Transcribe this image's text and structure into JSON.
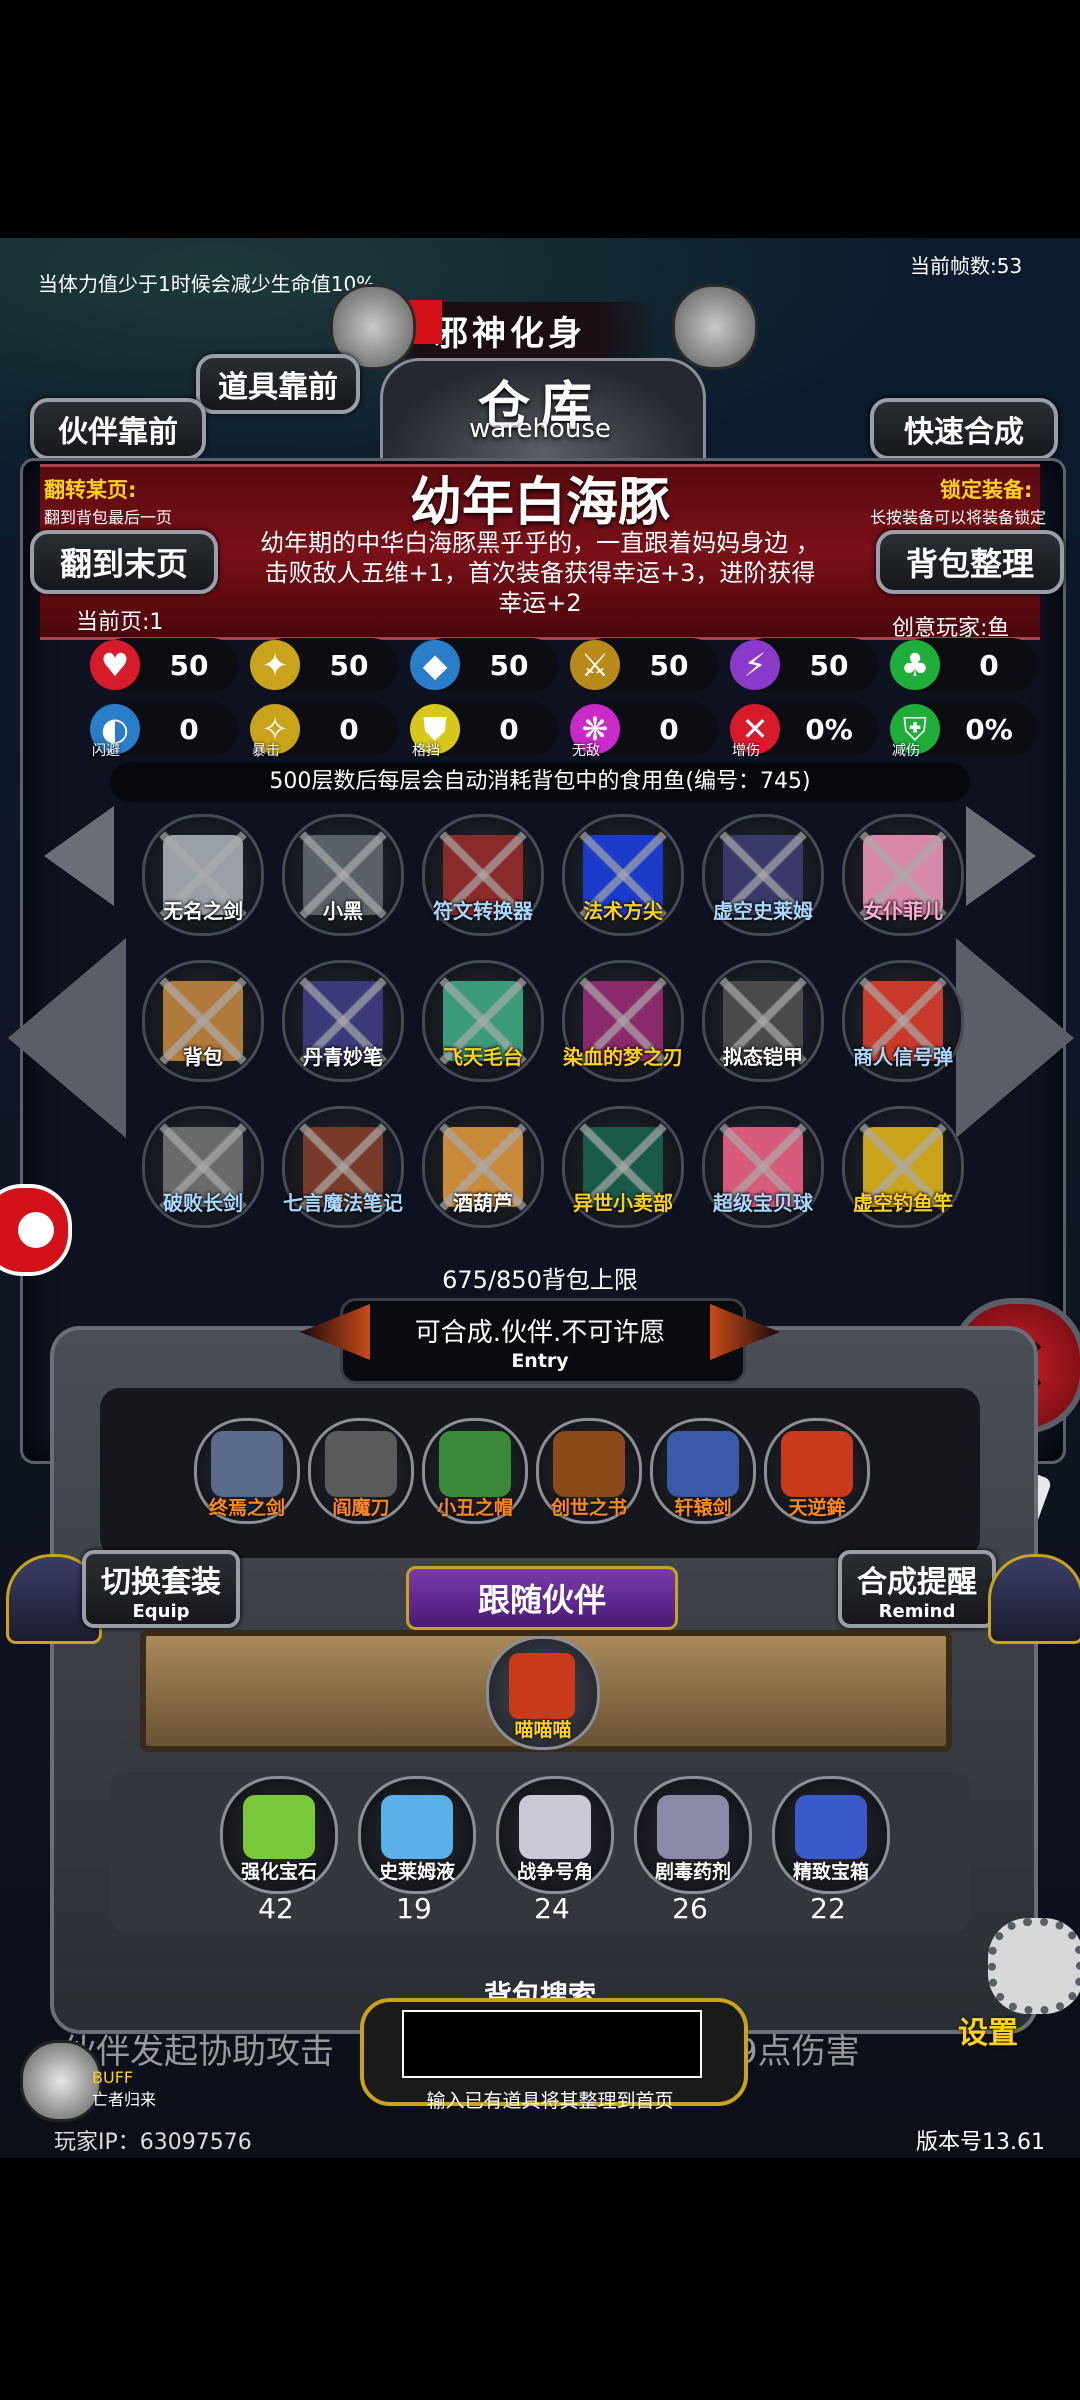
{
  "top_notice": "当体力值少于1时候会减少生命值10%",
  "frame_count": "当前帧数:53",
  "title_banner": "邪神化身",
  "warehouse": {
    "title": "仓库",
    "subtitle": "warehouse"
  },
  "buttons": {
    "items_front": "道具靠前",
    "partner_front": "伙伴靠前",
    "quick_craft": "快速合成",
    "to_last_page": "翻到末页",
    "bag_sort": "背包整理",
    "switch_set": "切换套装",
    "switch_set_en": "Equip",
    "craft_remind": "合成提醒",
    "craft_remind_en": "Remind",
    "settings": "设置"
  },
  "page_turn": {
    "label": "翻转某页:",
    "hint": "翻到背包最后一页"
  },
  "lock_equip": {
    "label": "锁定装备:",
    "hint": "长按装备可以将装备锁定"
  },
  "selected_item": {
    "name": "幼年白海豚",
    "description": "幼年期的中华白海豚黑乎乎的，一直跟着妈妈身边 ， 击败敌人五维+1，首次装备获得幸运+3，进阶获得幸运+2"
  },
  "current_page": "当前页:1",
  "creator": "创意玩家:鱼",
  "stats_row1": [
    {
      "icon": "heart-icon",
      "value": "50",
      "color": "#d81b2a",
      "glyph": "♥"
    },
    {
      "icon": "armor-icon",
      "value": "50",
      "color": "#c9a31a",
      "glyph": "✦"
    },
    {
      "icon": "boot-icon",
      "value": "50",
      "color": "#2a7ec9",
      "glyph": "◆"
    },
    {
      "icon": "sword-icon",
      "value": "50",
      "color": "#b88a1a",
      "glyph": "⚔"
    },
    {
      "icon": "lightning-icon",
      "value": "50",
      "color": "#8a3ac9",
      "glyph": "⚡"
    },
    {
      "icon": "clover-icon",
      "value": "0",
      "color": "#1fae3a",
      "glyph": "♣"
    }
  ],
  "stats_row2": [
    {
      "icon": "dodge-icon",
      "value": "0",
      "label": "闪避",
      "color": "#2a7ec9",
      "glyph": "◐"
    },
    {
      "icon": "crit-icon",
      "value": "0",
      "label": "暴击",
      "color": "#c9a31a",
      "glyph": "✧"
    },
    {
      "icon": "block-icon",
      "value": "0",
      "label": "格挡",
      "color": "#d8c81a",
      "glyph": "⛊"
    },
    {
      "icon": "invincible-icon",
      "value": "0",
      "label": "无敌",
      "color": "#c92ac9",
      "glyph": "❋"
    },
    {
      "icon": "damage-up-icon",
      "value": "0%",
      "label": "增伤",
      "color": "#d81b2a",
      "glyph": "✕"
    },
    {
      "icon": "damage-down-icon",
      "value": "0%",
      "label": "减伤",
      "color": "#1fae3a",
      "glyph": "⛨"
    }
  ],
  "fish_notice": "500层数后每层会自动消耗背包中的食用鱼(编号：745)",
  "inventory": [
    {
      "name": "无名之剑",
      "color": "#9aa0a8",
      "label_color": "#ffffff"
    },
    {
      "name": "小黑",
      "color": "#5a6068",
      "label_color": "#ffffff"
    },
    {
      "name": "符文转换器",
      "color": "#8a2a2a",
      "label_color": "#a8d8ff"
    },
    {
      "name": "法术方尖",
      "color": "#1a3ac9",
      "label_color": "#ffd21a"
    },
    {
      "name": "虚空史莱姆",
      "color": "#3a3a6a",
      "label_color": "#a8d8ff"
    },
    {
      "name": "女仆菲儿",
      "color": "#d888a8",
      "label_color": "#ffb0d8"
    },
    {
      "name": "背包",
      "color": "#b07a3a",
      "label_color": "#ffffff"
    },
    {
      "name": "丹青妙笔",
      "color": "#3a3a7a",
      "label_color": "#ffffff"
    },
    {
      "name": "飞天毛台",
      "color": "#3a9a7a",
      "label_color": "#ffd21a"
    },
    {
      "name": "染血的梦之刃",
      "color": "#8a2a6a",
      "label_color": "#ffd21a"
    },
    {
      "name": "拟态铠甲",
      "color": "#4a4a4a",
      "label_color": "#ffffff"
    },
    {
      "name": "商人信号弹",
      "color": "#c93a2a",
      "label_color": "#a8d8ff"
    },
    {
      "name": "破败长剑",
      "color": "#6a6a6a",
      "label_color": "#a8d8ff"
    },
    {
      "name": "七言魔法笔记",
      "color": "#7a3a2a",
      "label_color": "#a8d8ff"
    },
    {
      "name": "酒葫芦",
      "color": "#c98a3a",
      "label_color": "#ffffff"
    },
    {
      "name": "异世小卖部",
      "color": "#1a5a4a",
      "label_color": "#ffd21a"
    },
    {
      "name": "超级宝贝球",
      "color": "#d85a7a",
      "label_color": "#a8d8ff"
    },
    {
      "name": "虚空钓鱼竿",
      "color": "#c9a31a",
      "label_color": "#ffd21a"
    }
  ],
  "bag_capacity": "675/850背包上限",
  "entry": {
    "text": "可合成.伙伴.不可许愿",
    "en": "Entry"
  },
  "equipped": [
    {
      "name": "终焉之剑",
      "color": "#5a6a8a"
    },
    {
      "name": "阎魔刀",
      "color": "#5a5a5a"
    },
    {
      "name": "小丑之帽",
      "color": "#3a8a3a"
    },
    {
      "name": "创世之书",
      "color": "#8a4a1a"
    },
    {
      "name": "轩辕剑",
      "color": "#3a5aa8"
    },
    {
      "name": "天逆鉾",
      "color": "#c93a1a"
    }
  ],
  "follow_partner": {
    "title": "跟随伙伴",
    "name": "喵喵喵"
  },
  "materials": [
    {
      "name": "强化宝石",
      "count": "42",
      "color": "#7ac93a"
    },
    {
      "name": "史莱姆液",
      "count": "19",
      "color": "#5ab0e8"
    },
    {
      "name": "战争号角",
      "count": "24",
      "color": "#c9c9d8"
    },
    {
      "name": "剧毒药剂",
      "count": "26",
      "color": "#8a8aa8"
    },
    {
      "name": "精致宝箱",
      "count": "22",
      "color": "#3a5ac9"
    }
  ],
  "search": {
    "title": "背包搜索",
    "hint": "输入已有道具将其整理到首页",
    "value": ""
  },
  "scroll_text_left": "伙伴发起协助攻击",
  "scroll_text_right": "9点伤害",
  "buff": {
    "label": "BUFF",
    "sub": "亡者归来"
  },
  "player_ip": "玩家IP：63097576",
  "version": "版本号13.61",
  "colors": {
    "gold": "#ffd21a",
    "red": "#d81b2a",
    "panel_bg": "#0e1220"
  }
}
